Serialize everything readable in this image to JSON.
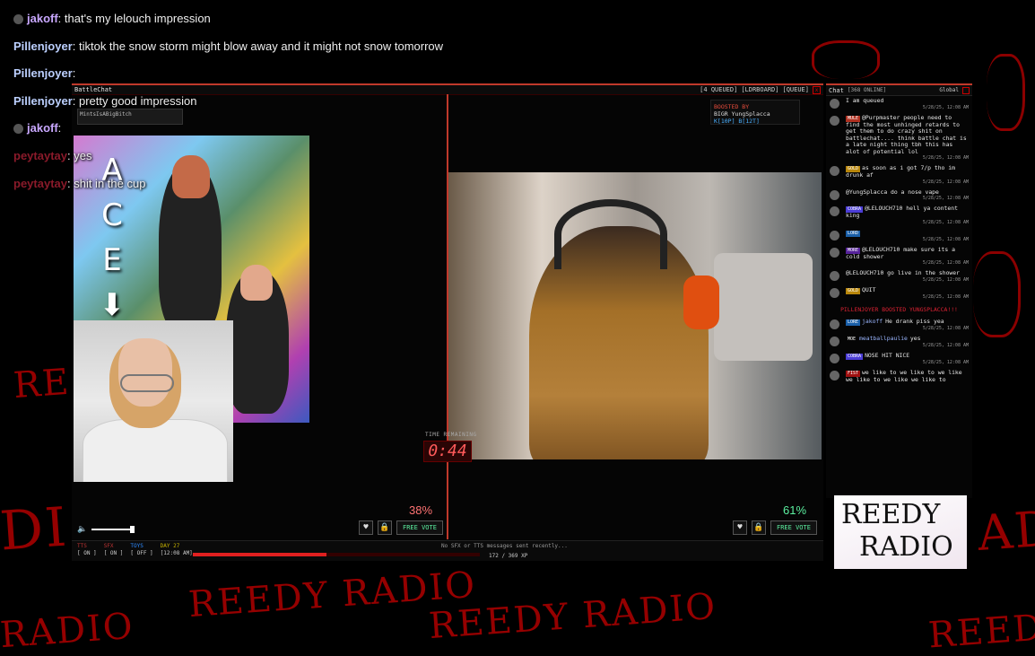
{
  "overlay_chat": [
    {
      "user": "jakoff",
      "text": ": that's my lelouch impression",
      "style": "purple",
      "icon": true
    },
    {
      "user": "Pillenjoyer",
      "text": ": tiktok the snow storm might blow away and it might not snow tomorrow",
      "style": "blue",
      "icon": false
    },
    {
      "user": "Pillenjoyer",
      "text": ":",
      "style": "blue",
      "icon": false
    },
    {
      "user": "Pillenjoyer",
      "text": ": pretty good impression",
      "style": "blue",
      "icon": false
    },
    {
      "user": "jakoff",
      "text": ":",
      "style": "purple",
      "icon": true
    },
    {
      "user": "peytaytay",
      "text": ": yes",
      "style": "red",
      "icon": false
    },
    {
      "user": "peytaytay",
      "text": ": shit in the cup",
      "style": "red",
      "icon": false
    }
  ],
  "window": {
    "title": "BattleChat",
    "menu": [
      "[4 QUEUED]",
      "[LDRBOARD]",
      "[QUEUE]"
    ],
    "close": "x"
  },
  "left_video": {
    "mini_label": "MintsIsABigBitch",
    "letters": [
      "A",
      "C",
      "E",
      "⬇"
    ]
  },
  "boost_box": {
    "line1": "BOOSTED BY",
    "line2": "BIGR YungSplacca",
    "line3": "K[10P] B[12T]"
  },
  "timer": {
    "label": "TIME REMAINING",
    "value": "0:44"
  },
  "vote": {
    "left_pct": "38%",
    "right_pct": "61%",
    "heart": "♥",
    "lock": "🔒",
    "button": "FREE VOTE"
  },
  "volume": {
    "icon": "🔈",
    "level": 1.0
  },
  "status": {
    "cols": [
      {
        "h": "TTS",
        "v": "[ ON ]",
        "color": "red"
      },
      {
        "h": "SFX",
        "v": "[ ON ]",
        "color": "red"
      },
      {
        "h": "TOYS",
        "v": "[ OFF ]",
        "color": "blue"
      },
      {
        "h": "DAY 27",
        "v": "[12:08 AM]",
        "color": "yellow"
      }
    ],
    "message": "No SFX or TTS messages sent recently...",
    "count": "172 / 369 XP",
    "progress": 0.466
  },
  "chat": {
    "title": "Chat",
    "online": "[368 ONLINE]",
    "channel": "Global",
    "messages": [
      {
        "badge": "",
        "badgeClass": "",
        "name": "",
        "text": "I am queued",
        "time": "5/28/25, 12:08 AM"
      },
      {
        "badge": "MULE",
        "badgeClass": "mule",
        "name": "",
        "text": "@Purpmaster people need to find the most unhinged retards to get them to do crazy shit on battlechat.... think battle chat is a late night thing tbh this has alot of potential lol",
        "time": "5/28/25, 12:08 AM"
      },
      {
        "badge": "GOLD",
        "badgeClass": "gold",
        "name": "",
        "text": "as soon as i got 7/p tho im drunk af",
        "time": "5/28/25, 12:08 AM"
      },
      {
        "badge": "",
        "badgeClass": "",
        "name": "",
        "text": "@YungSplacca do a nose vape",
        "time": "5/28/25, 12:08 AM"
      },
      {
        "badge": "COBRA",
        "badgeClass": "cobra",
        "name": "",
        "text": "@LELOUCH710 hell ya content king",
        "time": "5/28/25, 12:08 AM"
      },
      {
        "badge": "LORD",
        "badgeClass": "lord",
        "name": "",
        "text": "",
        "time": "5/28/25, 12:08 AM"
      },
      {
        "badge": "MORE",
        "badgeClass": "more",
        "name": "",
        "text": "@LELOUCH710 make sure its a cold shower",
        "time": "5/28/25, 12:08 AM"
      },
      {
        "badge": "",
        "badgeClass": "",
        "name": "",
        "text": "@LELOUCH710 go live in the shower",
        "time": "5/28/25, 12:08 AM"
      },
      {
        "badge": "GOLD",
        "badgeClass": "gold",
        "name": "",
        "text": "QUIT",
        "time": "5/28/25, 12:08 AM"
      }
    ],
    "boost": "PILLENJOYER BOOSTED YUNGSPLACCA!!!",
    "messages2": [
      {
        "badge": "LORE",
        "badgeClass": "lord",
        "name": "jakoff",
        "text": "He drank piss yea",
        "time": "5/28/25, 12:08 AM"
      },
      {
        "badge": "MOE",
        "badgeClass": "",
        "name": "meatballpaulie",
        "text": "yes",
        "time": "5/28/25, 12:08 AM"
      },
      {
        "badge": "COBRA",
        "badgeClass": "cobra",
        "name": "",
        "text": "NOSE HIT NICE",
        "time": "5/28/25, 12:08 AM"
      },
      {
        "badge": "FIST",
        "badgeClass": "fist",
        "name": "",
        "text": "we like to we like to we like we like to we like we like to",
        "time": ""
      }
    ]
  },
  "reedy_box": {
    "line1": "REEDY",
    "line2": "RADIO"
  },
  "background_text": [
    "REEDY RADIO",
    "REEDY RADIO",
    "RADIO",
    "REEDY",
    "RE",
    "DI",
    "AD"
  ]
}
